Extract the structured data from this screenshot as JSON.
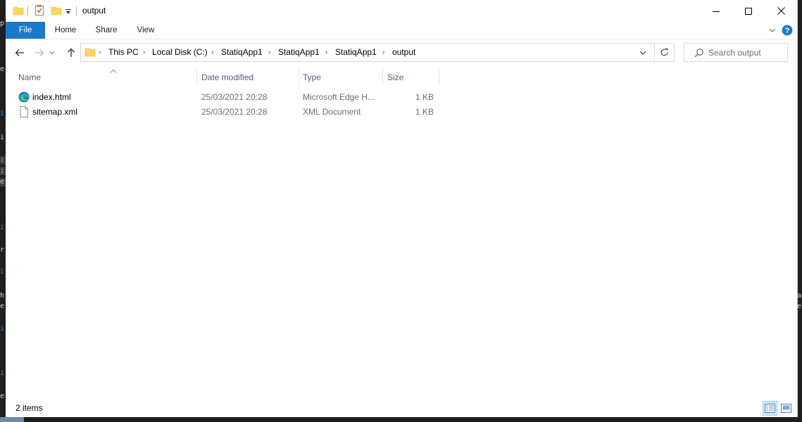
{
  "window": {
    "title": "output"
  },
  "ribbon": {
    "tabs": [
      "File",
      "Home",
      "Share",
      "View"
    ]
  },
  "address": {
    "crumbs": [
      "This PC",
      "Local Disk (C:)",
      "StatiqApp1",
      "StatiqApp1",
      "StatiqApp1",
      "output"
    ]
  },
  "search": {
    "placeholder": "Search output"
  },
  "columns": {
    "name": "Name",
    "date": "Date modified",
    "type": "Type",
    "size": "Size"
  },
  "files": [
    {
      "name": "index.html",
      "date": "25/03/2021 20:28",
      "type": "Microsoft Edge H...",
      "size": "1 KB",
      "icon": "edge-html-icon"
    },
    {
      "name": "sitemap.xml",
      "date": "25/03/2021 20:28",
      "type": "XML Document",
      "size": "1 KB",
      "icon": "xml-file-icon"
    }
  ],
  "status": {
    "item_count": "2 items"
  },
  "colors": {
    "file_tab": "#1979ca",
    "folder": "#ffd75e",
    "header_text": "#4c607a",
    "selected_view": "#cce8ff"
  }
}
